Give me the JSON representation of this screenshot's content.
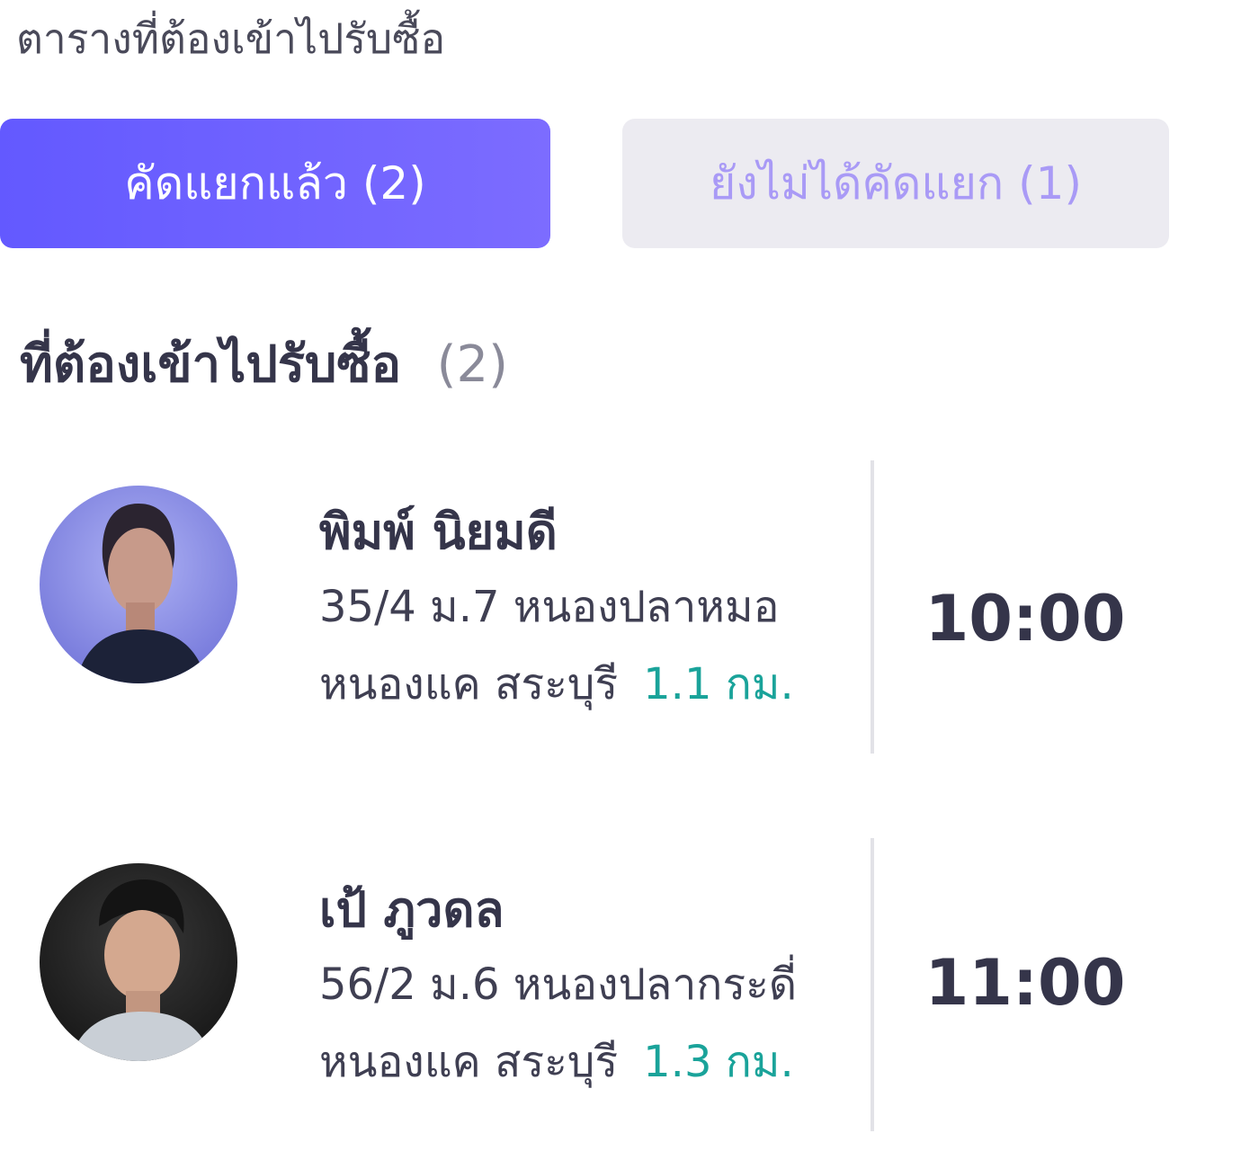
{
  "header": {
    "title": "ตารางที่ต้องเข้าไปรับซื้อ"
  },
  "tabs": [
    {
      "label": "คัดแยกแล้ว",
      "count": "(2)",
      "active": true
    },
    {
      "label": "ยังไม่ได้คัดแยก",
      "count": "(1)",
      "active": false
    }
  ],
  "section": {
    "title": "ที่ต้องเข้าไปรับซื้อ",
    "count": "(2)"
  },
  "pickups": [
    {
      "name": "พิมพ์ นิยมดี",
      "address_line1": "35/4 ม.7 หนองปลาหมอ",
      "address_line2": "หนองแค สระบุรี",
      "distance": "1.1 กม.",
      "time": "10:00"
    },
    {
      "name": "เป้ ภูวดล",
      "address_line1": "56/2 ม.6 หนองปลากระดี่",
      "address_line2": "หนองแค สระบุรี",
      "distance": "1.3 กม.",
      "time": "11:00"
    }
  ],
  "colors": {
    "accent": "#6c63ff",
    "distance": "#1aa39a",
    "inactive_tab_bg": "#ecebf1",
    "inactive_tab_text": "#a99af6"
  }
}
